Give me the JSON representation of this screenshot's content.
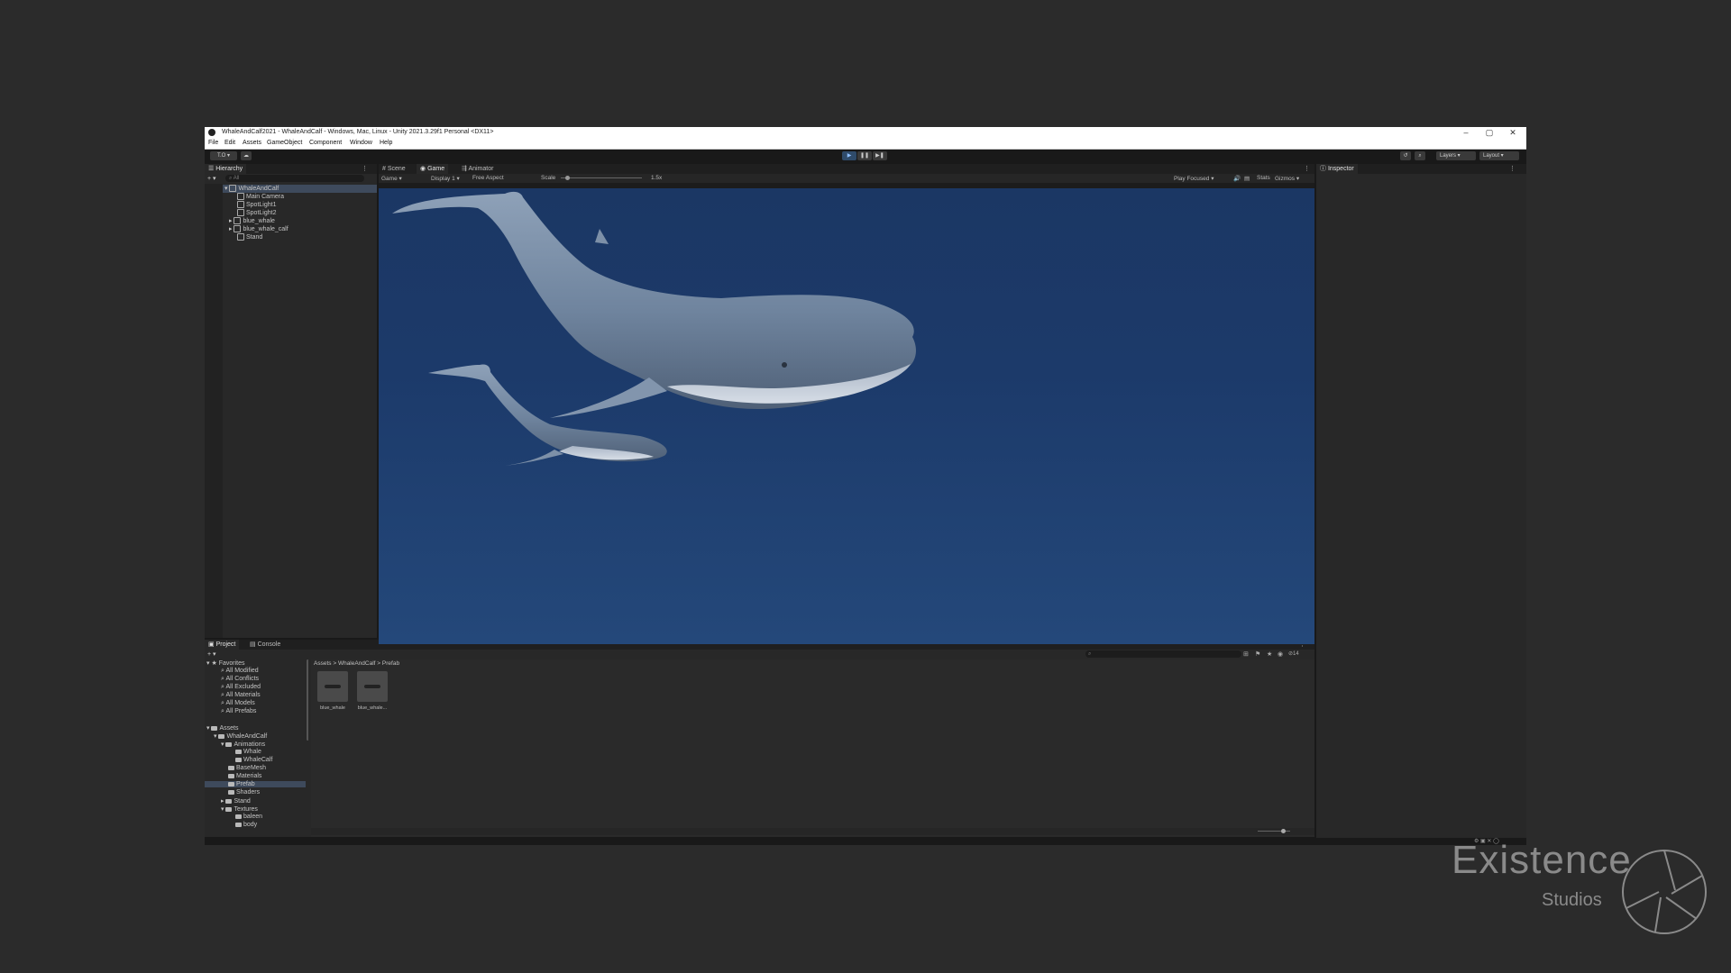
{
  "window": {
    "title": "WhaleAndCalf2021 - WhaleAndCalf - Windows, Mac, Linux - Unity 2021.3.29f1 Personal <DX11>",
    "controls": [
      "–",
      "▢",
      "✕"
    ]
  },
  "menu": [
    "File",
    "Edit",
    "Assets",
    "GameObject",
    "Component",
    "Window",
    "Help"
  ],
  "toolbar": {
    "account": "T.O",
    "layers": "Layers",
    "layout": "Layout"
  },
  "hierarchy": {
    "tab": "Hierarchy",
    "search_placeholder": "All",
    "items": [
      {
        "label": "WhaleAndCalf",
        "depth": 0
      },
      {
        "label": "Main Camera",
        "depth": 1
      },
      {
        "label": "SpotLight1",
        "depth": 1
      },
      {
        "label": "SpotLight2",
        "depth": 1
      },
      {
        "label": "blue_whale",
        "depth": 1
      },
      {
        "label": "blue_whale_calf",
        "depth": 1
      },
      {
        "label": "Stand",
        "depth": 1
      }
    ]
  },
  "view_tabs": [
    "Scene",
    "Game",
    "Animator"
  ],
  "game_toolbar": {
    "camera": "Game",
    "display": "Display 1",
    "aspect": "Free Aspect",
    "scale_label": "Scale",
    "scale_value": "1.5x",
    "play_focused": "Play Focused",
    "stats": "Stats",
    "gizmos": "Gizmos"
  },
  "inspector": {
    "tab": "Inspector"
  },
  "bottom_tabs": [
    "Project",
    "Console"
  ],
  "project": {
    "favorites_label": "Favorites",
    "favorites": [
      "All Modified",
      "All Conflicts",
      "All Excluded",
      "All Materials",
      "All Models",
      "All Prefabs"
    ],
    "assets_label": "Assets",
    "asset_tree": [
      {
        "label": "WhaleAndCalf",
        "depth": 1
      },
      {
        "label": "Animations",
        "depth": 2
      },
      {
        "label": "Whale",
        "depth": 3
      },
      {
        "label": "WhaleCalf",
        "depth": 3
      },
      {
        "label": "BaseMesh",
        "depth": 2
      },
      {
        "label": "Materials",
        "depth": 2
      },
      {
        "label": "Prefab",
        "depth": 2
      },
      {
        "label": "Shaders",
        "depth": 2
      },
      {
        "label": "Stand",
        "depth": 2
      },
      {
        "label": "Textures",
        "depth": 2
      },
      {
        "label": "baleen",
        "depth": 3
      },
      {
        "label": "body",
        "depth": 3
      }
    ],
    "breadcrumb": [
      "Assets",
      "WhaleAndCalf",
      "Prefab"
    ],
    "files": [
      "blue_whale",
      "blue_whale..."
    ],
    "count": "14"
  },
  "watermark": {
    "brand": "Existence",
    "sub": "Studios"
  }
}
